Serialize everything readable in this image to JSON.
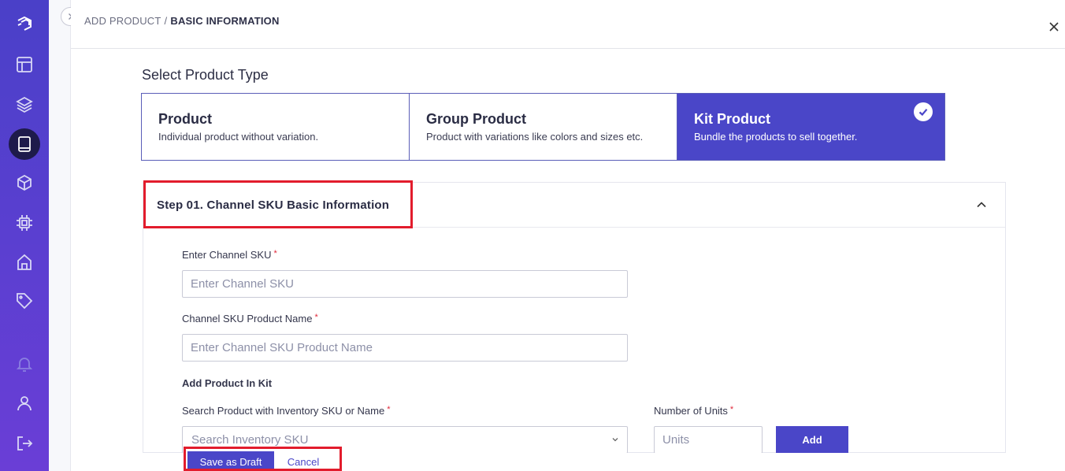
{
  "sidebar": {
    "items": [
      {
        "icon": "logo-icon"
      },
      {
        "icon": "layout-icon"
      },
      {
        "icon": "layers-icon"
      },
      {
        "icon": "book-icon",
        "active": true
      },
      {
        "icon": "box-icon"
      },
      {
        "icon": "chip-icon"
      },
      {
        "icon": "home-icon"
      },
      {
        "icon": "tag-icon"
      },
      {
        "icon": "bell-icon"
      },
      {
        "icon": "user-icon"
      },
      {
        "icon": "logout-icon"
      }
    ]
  },
  "header": {
    "breadcrumb_root": "ADD PRODUCT",
    "breadcrumb_sep": "/",
    "breadcrumb_current": "BASIC INFORMATION"
  },
  "product_type": {
    "title": "Select Product Type",
    "options": [
      {
        "title": "Product",
        "desc": "Individual product without variation."
      },
      {
        "title": "Group Product",
        "desc": "Product with variations like colors and sizes etc."
      },
      {
        "title": "Kit Product",
        "desc": "Bundle the products to sell together.",
        "selected": true
      }
    ]
  },
  "step": {
    "title": "Step 01. Channel SKU Basic Information",
    "channel_sku": {
      "label": "Enter Channel SKU",
      "required": "*",
      "placeholder": "Enter Channel SKU"
    },
    "product_name": {
      "label": "Channel SKU Product Name",
      "required": "*",
      "placeholder": "Enter Channel SKU Product Name"
    },
    "kit_heading": "Add Product In Kit",
    "search": {
      "label": "Search Product with Inventory SKU or Name",
      "required": "*",
      "placeholder": "Search Inventory SKU"
    },
    "units": {
      "label": "Number of Units",
      "required": "*",
      "placeholder": "Units"
    },
    "add_label": "Add"
  },
  "footer": {
    "save_draft": "Save as Draft",
    "cancel": "Cancel"
  },
  "colors": {
    "primary": "#4a46c8",
    "sidebar_top": "#4a40c8",
    "highlight": "#e21c2c",
    "required": "#e0283a"
  }
}
